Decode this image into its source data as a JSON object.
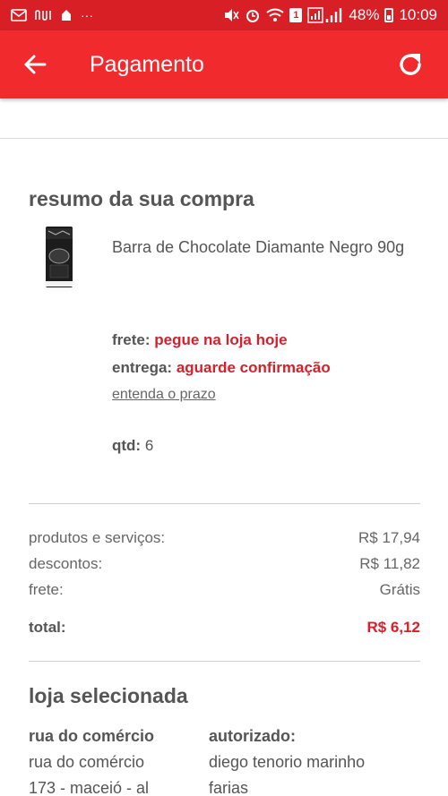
{
  "status_bar": {
    "battery": "48%",
    "time": "10:09",
    "sim_badge": "1",
    "left_icons": [
      "email-icon",
      "nubank-icon",
      "app-icon",
      "more-icon"
    ],
    "more_dots": "···"
  },
  "header": {
    "title": "Pagamento",
    "background": "#f12a2e",
    "status_background": "#d81f26"
  },
  "summary": {
    "title": "resumo da sua compra",
    "product_name": "Barra de Chocolate Diamante Negro 90g",
    "frete_label": "frete:",
    "frete_value": "pegue na loja hoje",
    "entrega_label": "entrega:",
    "entrega_value": "aguarde confirmação",
    "prazo_link": "entenda o prazo",
    "qtd_label": "qtd:",
    "qtd_value": "6"
  },
  "totals": {
    "produtos_label": "produtos e serviços:",
    "produtos_value": "R$ 17,94",
    "descontos_label": "descontos:",
    "descontos_value": "R$ 11,82",
    "frete_label": "frete:",
    "frete_value": "Grátis",
    "total_label": "total:",
    "total_value": "R$ 6,12"
  },
  "store": {
    "title": "loja selecionada",
    "address_header": "rua do comércio",
    "address_line1": "rua do comércio",
    "address_line2": "173 - maceió - al",
    "authorized_header": "autorizado:",
    "authorized_line1": "diego tenorio marinho",
    "authorized_line2": "farias"
  },
  "colors": {
    "accent": "#d6202c"
  }
}
